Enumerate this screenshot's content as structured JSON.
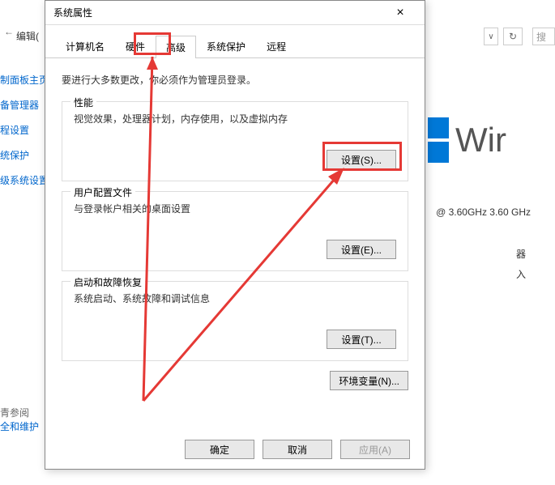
{
  "bg": {
    "edit_label": "编辑(",
    "search_placeholder": "搜",
    "sidebar_links": [
      "制面板主页",
      "备管理器",
      "程设置",
      "统保护",
      "级系统设置"
    ],
    "see_also": "青参阅",
    "sec_link": "全和维护",
    "win_text": "Wir",
    "cpu": "@ 3.60GHz   3.60 GHz",
    "label1": "器",
    "label2": "入"
  },
  "dialog": {
    "title": "系统属性",
    "tabs": [
      "计算机名",
      "硬件",
      "高级",
      "系统保护",
      "远程"
    ],
    "active_tab_index": 2,
    "instruction": "要进行大多数更改，你必须作为管理员登录。",
    "groups": {
      "perf": {
        "title": "性能",
        "desc": "视觉效果，处理器计划，内存使用，以及虚拟内存",
        "btn": "设置(S)..."
      },
      "profile": {
        "title": "用户配置文件",
        "desc": "与登录帐户相关的桌面设置",
        "btn": "设置(E)..."
      },
      "startup": {
        "title": "启动和故障恢复",
        "desc": "系统启动、系统故障和调试信息",
        "btn": "设置(T)..."
      }
    },
    "env_btn": "环境变量(N)...",
    "footer": {
      "ok": "确定",
      "cancel": "取消",
      "apply": "应用(A)"
    }
  }
}
